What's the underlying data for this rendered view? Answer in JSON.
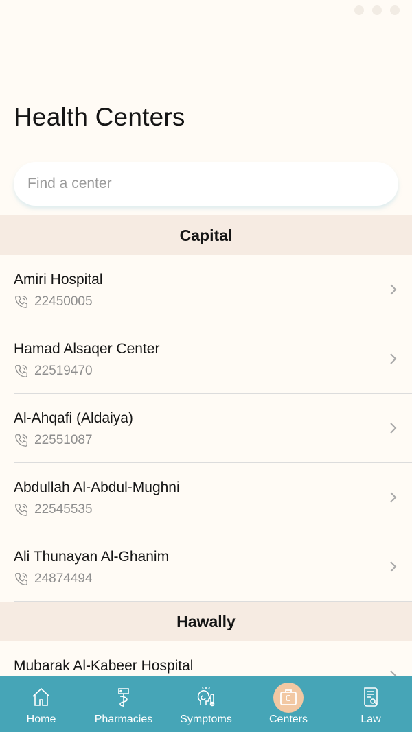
{
  "page": {
    "title": "Health Centers"
  },
  "search": {
    "placeholder": "Find a center"
  },
  "sections": [
    {
      "name": "Capital",
      "items": [
        {
          "name": "Amiri Hospital",
          "phone": "22450005"
        },
        {
          "name": "Hamad Alsaqer Center",
          "phone": "22519470"
        },
        {
          "name": "Al-Ahqafi (Aldaiya)",
          "phone": "22551087"
        },
        {
          "name": "Abdullah Al-Abdul-Mughni",
          "phone": "22545535"
        },
        {
          "name": "Ali Thunayan Al-Ghanim",
          "phone": "24874494"
        }
      ]
    },
    {
      "name": "Hawally",
      "items": [
        {
          "name": "Mubarak Al-Kabeer Hospital"
        }
      ]
    }
  ],
  "nav": {
    "items": [
      {
        "label": "Home",
        "icon": "home-icon"
      },
      {
        "label": "Pharmacies",
        "icon": "pharmacy-icon"
      },
      {
        "label": "Symptoms",
        "icon": "symptoms-icon"
      },
      {
        "label": "Centers",
        "icon": "centers-icon",
        "active": true
      },
      {
        "label": "Law",
        "icon": "law-icon"
      }
    ]
  },
  "colors": {
    "background": "#fffbf5",
    "section_header": "#f6ebe2",
    "nav_bar": "#46a5b7",
    "active_bubble": "#f2c8a3"
  }
}
